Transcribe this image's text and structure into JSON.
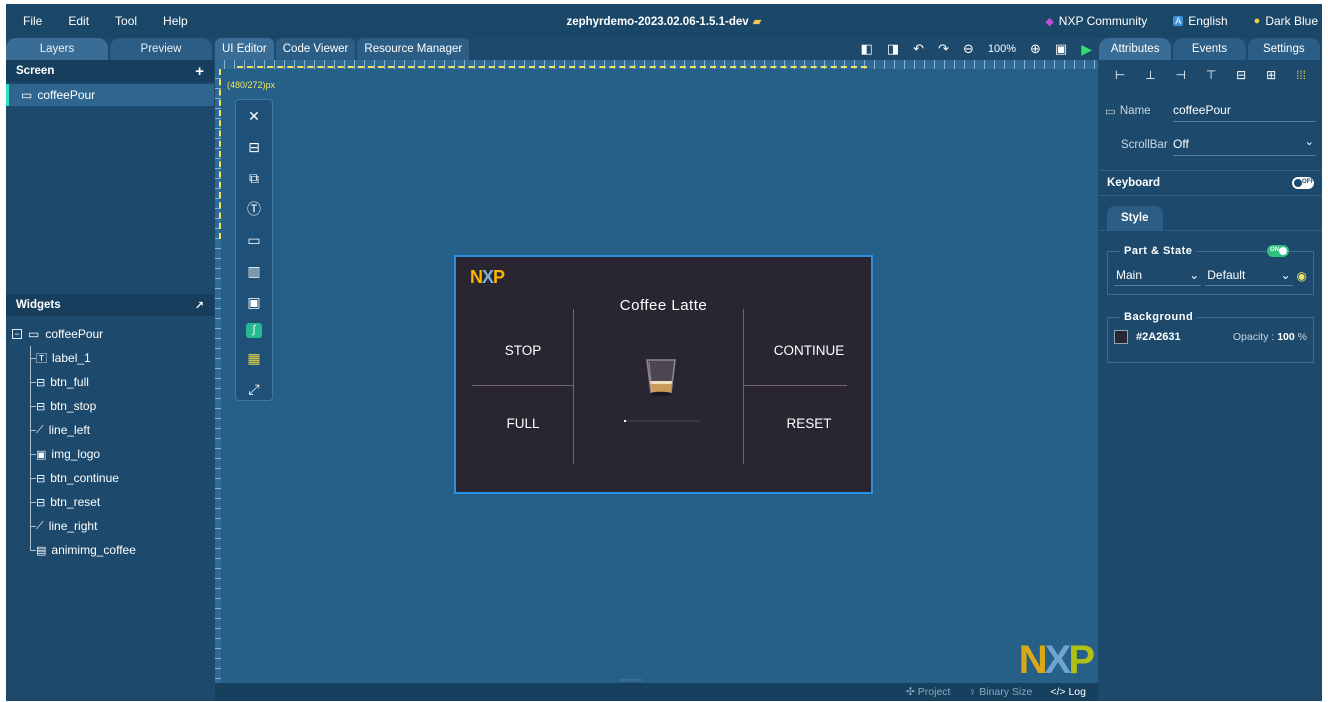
{
  "menu": {
    "items": [
      "File",
      "Edit",
      "Tool",
      "Help"
    ],
    "title": "zephyrdemo-2023.02.06-1.5.1-dev",
    "right": {
      "community": "NXP Community",
      "language": "English",
      "theme": "Dark Blue"
    }
  },
  "left_panel": {
    "tabs": [
      "Layers",
      "Preview"
    ],
    "screen_section": {
      "title": "Screen",
      "items": [
        "coffeePour"
      ]
    },
    "widgets_section": {
      "title": "Widgets",
      "root": "coffeePour",
      "children": [
        {
          "label": "label_1",
          "icon": "label-icon",
          "glyph": "🅃"
        },
        {
          "label": "btn_full",
          "icon": "button-icon",
          "glyph": "⊟"
        },
        {
          "label": "btn_stop",
          "icon": "button-icon",
          "glyph": "⊟"
        },
        {
          "label": "line_left",
          "icon": "line-icon",
          "glyph": "⟋"
        },
        {
          "label": "img_logo",
          "icon": "image-icon",
          "glyph": "▣"
        },
        {
          "label": "btn_continue",
          "icon": "button-icon",
          "glyph": "⊟"
        },
        {
          "label": "btn_reset",
          "icon": "button-icon",
          "glyph": "⊟"
        },
        {
          "label": "line_right",
          "icon": "line-icon",
          "glyph": "⟋"
        },
        {
          "label": "animimg_coffee",
          "icon": "animimg-icon",
          "glyph": "▤"
        }
      ]
    }
  },
  "center": {
    "tabs": [
      "UI Editor",
      "Code Viewer",
      "Resource Manager"
    ],
    "zoom": "100%",
    "resolution": "(480/272)px",
    "bottom": {
      "project": "Project",
      "binary": "Binary Size",
      "log": "Log"
    },
    "device": {
      "logo": "NXP",
      "title": "Coffee Latte",
      "buttons": {
        "stop": "STOP",
        "full": "FULL",
        "continue": "CONTINUE",
        "reset": "RESET"
      },
      "background": "#2A2631",
      "progress": 0.03
    },
    "corner_logo": "NXP"
  },
  "right_panel": {
    "tabs": [
      "Attributes",
      "Events",
      "Settings"
    ],
    "name_label": "Name",
    "name_value": "coffeePour",
    "scrollbar_label": "ScrollBar",
    "scrollbar_value": "Off",
    "keyboard_label": "Keyboard",
    "keyboard_toggle": "OFF",
    "style_tab": "Style",
    "part_state": {
      "title": "Part & State",
      "toggle": "ON",
      "part": "Main",
      "state": "Default"
    },
    "background": {
      "title": "Background",
      "hex": "#2A2631",
      "opacity_label": "Opacity :",
      "opacity_value": "100",
      "opacity_unit": "%"
    }
  },
  "colors": {
    "accent_teal": "#2ee0c4",
    "ruler_yellow": "#f1e35c",
    "nxp_yellow": "#f9b500",
    "run_green": "#2ee06a"
  }
}
